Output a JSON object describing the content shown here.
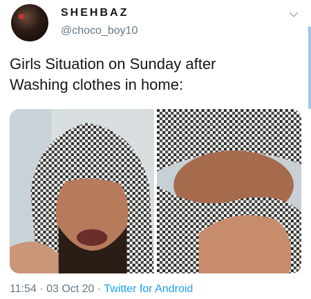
{
  "author": {
    "display_name": "SHEHBAZ",
    "handle": "@choco_boy10"
  },
  "tweet": {
    "text_line1": "Girls Situation on Sunday after",
    "text_line2": "Washing clothes in home:",
    "media_count": 2
  },
  "meta": {
    "timestamp": "11:54 · 03 Oct 20 · ",
    "source": "Twitter for Android"
  },
  "icons": {
    "menu": "chevron-down-icon"
  },
  "colors": {
    "text": "#14171a",
    "secondary": "#657786",
    "link": "#1da1f2"
  }
}
